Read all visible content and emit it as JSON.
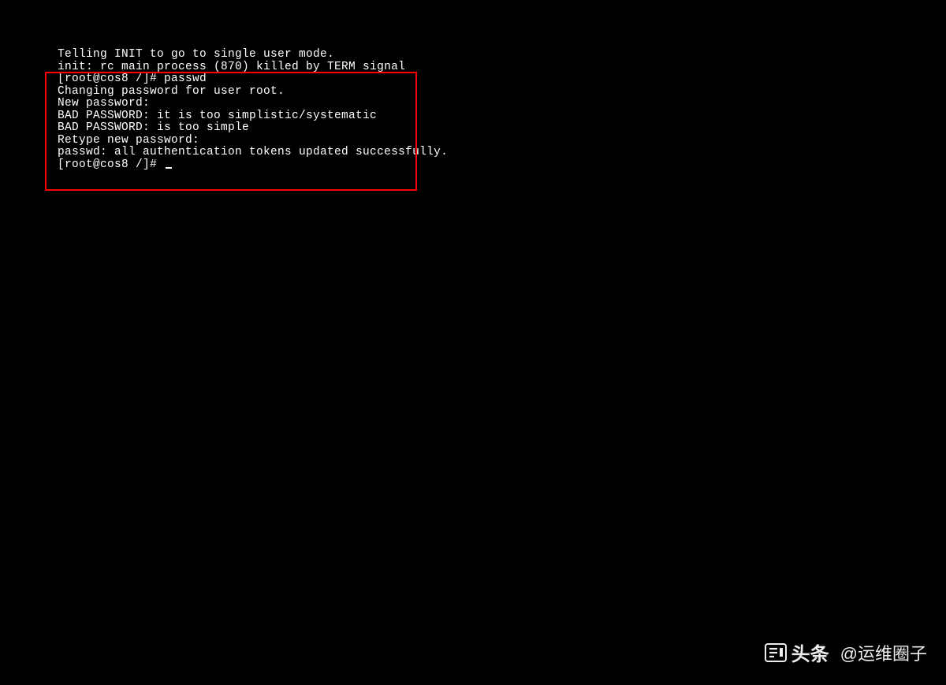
{
  "terminal": {
    "lines": [
      "Telling INIT to go to single user mode.",
      "init: rc main process (870) killed by TERM signal",
      "[root@cos8 /]# passwd",
      "Changing password for user root.",
      "New password:",
      "BAD PASSWORD: it is too simplistic/systematic",
      "BAD PASSWORD: is too simple",
      "Retype new password:",
      "passwd: all authentication tokens updated successfully.",
      "[root@cos8 /]# "
    ]
  },
  "watermark": {
    "brand": "头条",
    "handle": "@运维圈子"
  }
}
